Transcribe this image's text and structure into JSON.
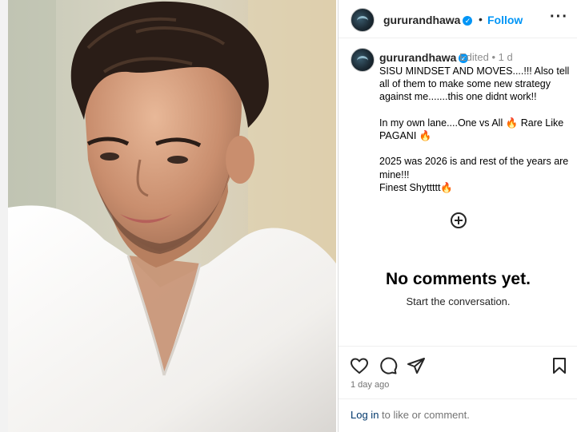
{
  "header": {
    "username": "gururandhawa",
    "verified_mark": "✓",
    "separator": "•",
    "follow_label": "Follow",
    "more_label": "···"
  },
  "caption": {
    "username": "gururandhawa",
    "edited_meta": "Edited • 1 d",
    "text": "SISU MINDSET AND MOVES....!!! Also tell all of them to make some new strategy against me.......this one didnt work!!\n\nIn my own lane....One vs All 🔥 Rare Like PAGANI 🔥\n\n2025 was 2026 is and rest of the years are mine!!!\nFinest Shyttttt🔥"
  },
  "comments": {
    "empty_title": "No comments yet.",
    "empty_subtitle": "Start the conversation."
  },
  "actions": {
    "icons": [
      "heart-icon",
      "comment-icon",
      "share-icon",
      "bookmark-icon"
    ],
    "timestamp": "1 day ago"
  },
  "footer": {
    "login_link": "Log in",
    "login_rest": " to like or comment."
  },
  "colors": {
    "accent": "#0095f6",
    "link_dark": "#00376b",
    "muted": "#737373"
  }
}
